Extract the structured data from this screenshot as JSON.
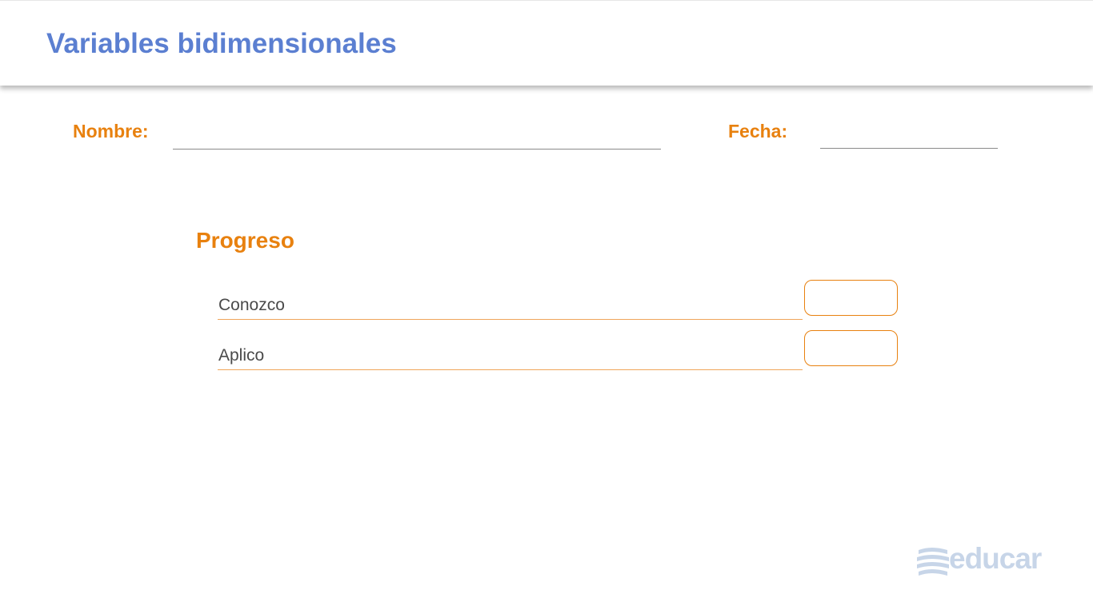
{
  "header": {
    "title": "Variables bidimensionales"
  },
  "form": {
    "name_label": "Nombre:",
    "date_label": "Fecha:"
  },
  "progress": {
    "title": "Progreso",
    "items": [
      {
        "label": "Conozco"
      },
      {
        "label": "Aplico"
      }
    ]
  },
  "logo": {
    "text": "educar",
    "icon": "stacked-books-icon"
  },
  "colors": {
    "title_blue": "#5b7fd1",
    "accent_orange": "#e8810f",
    "logo_gray_blue": "#c7d5e8"
  }
}
